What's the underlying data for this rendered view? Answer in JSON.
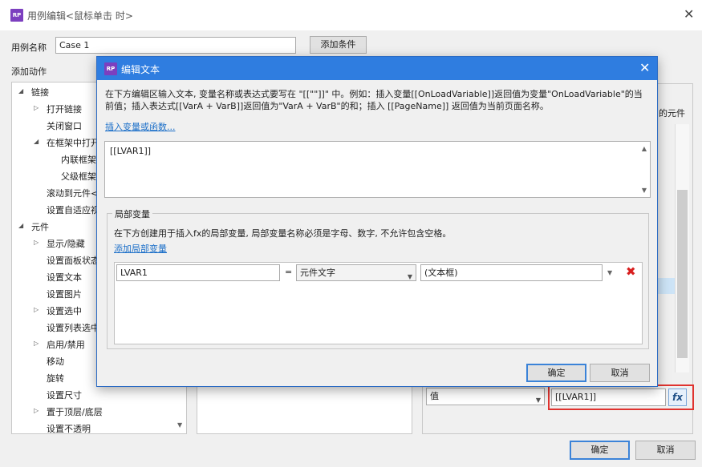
{
  "outer_dialog": {
    "title": "用例编辑<鼠标单击 时>",
    "case_name_label": "用例名称",
    "case_name_value": "Case 1",
    "add_condition": "添加条件",
    "add_action_label": "添加动作",
    "right_partial_label": "的元件",
    "value_type": "值",
    "value_text": "[[LVAR1]]",
    "fx_label": "fx",
    "ok": "确定",
    "cancel": "取消"
  },
  "action_tree": [
    {
      "label": "链接",
      "level": 0,
      "expanded": true
    },
    {
      "label": "打开链接",
      "level": 1,
      "expandable": true
    },
    {
      "label": "关闭窗口",
      "level": 1
    },
    {
      "label": "在框架中打开",
      "level": 1,
      "expanded": true
    },
    {
      "label": "内联框架",
      "level": 2
    },
    {
      "label": "父级框架",
      "level": 2
    },
    {
      "label": "滚动到元件<",
      "level": 1
    },
    {
      "label": "设置自适应视",
      "level": 1
    },
    {
      "label": "元件",
      "level": 0,
      "expanded": true
    },
    {
      "label": "显示/隐藏",
      "level": 1,
      "expandable": true
    },
    {
      "label": "设置面板状态",
      "level": 1
    },
    {
      "label": "设置文本",
      "level": 1
    },
    {
      "label": "设置图片",
      "level": 1
    },
    {
      "label": "设置选中",
      "level": 1,
      "expandable": true
    },
    {
      "label": "设置列表选中",
      "level": 1
    },
    {
      "label": "启用/禁用",
      "level": 1,
      "expandable": true
    },
    {
      "label": "移动",
      "level": 1
    },
    {
      "label": "旋转",
      "level": 1
    },
    {
      "label": "设置尺寸",
      "level": 1
    },
    {
      "label": "置于顶层/底层",
      "level": 1,
      "expandable": true
    },
    {
      "label": "设置不透明",
      "level": 1
    }
  ],
  "inner_dialog": {
    "title": "编辑文本",
    "description": "在下方编辑区输入文本, 变量名称或表达式要写在 \"[[\"\"]]\" 中。例如：插入变量[[OnLoadVariable]]返回值为变量\"OnLoadVariable\"的当前值；插入表达式[[VarA + VarB]]返回值为\"VarA + VarB\"的和；插入 [[PageName]] 返回值为当前页面名称。",
    "insert_link": "插入变量或函数...",
    "text_value": "[[LVAR1]]",
    "local_vars_title": "局部变量",
    "local_vars_desc": "在下方创建用于插入fx的局部变量, 局部变量名称必须是字母、数字, 不允许包含空格。",
    "add_local_var": "添加局部变量",
    "var_name": "LVAR1",
    "equals": "=",
    "var_type": "元件文字",
    "var_target": "(文本框)",
    "ok": "确定",
    "cancel": "取消"
  }
}
